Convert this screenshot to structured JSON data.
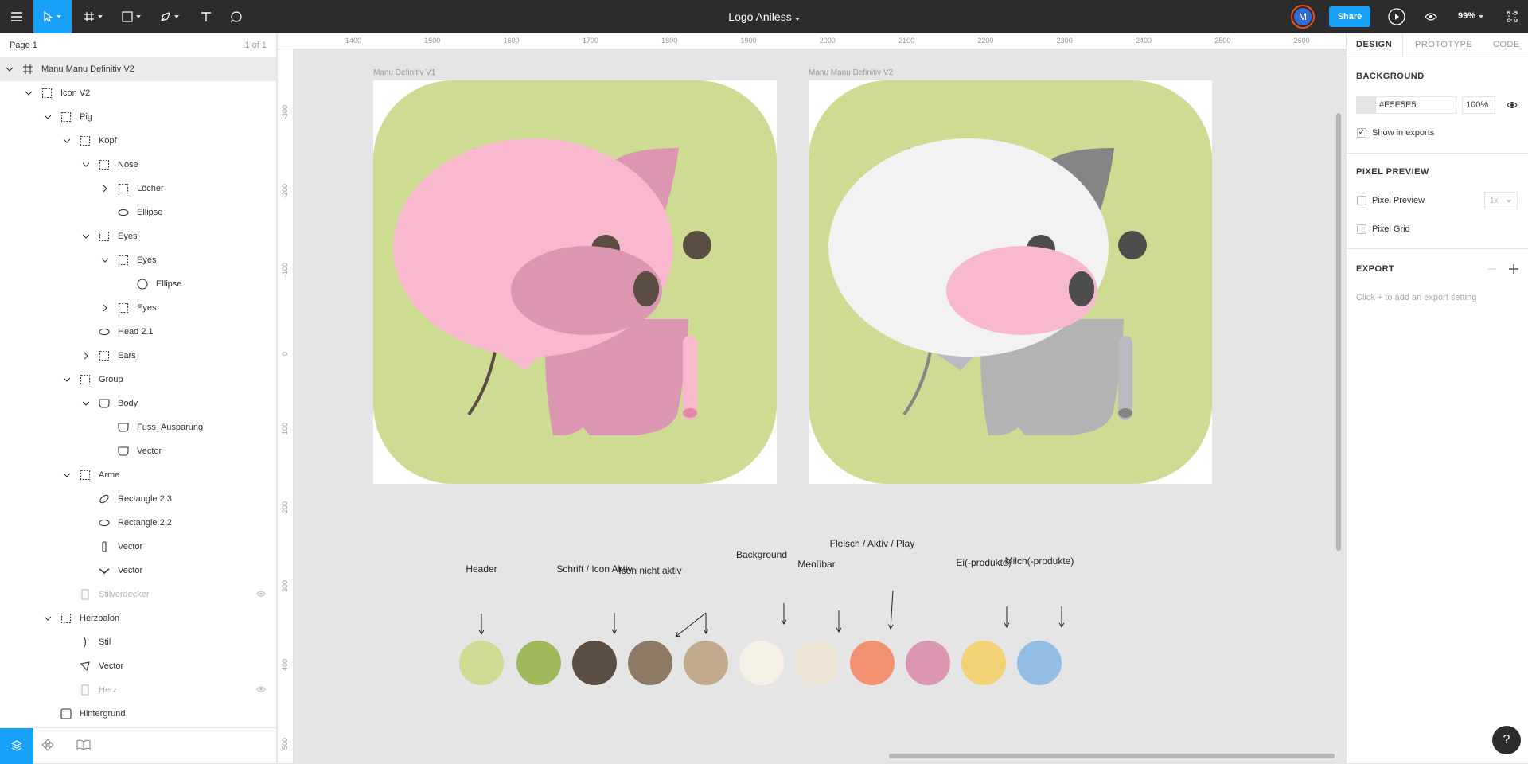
{
  "toolbar": {
    "file_title": "Logo Aniless",
    "avatar_initial": "M",
    "share_label": "Share",
    "zoom": "99%"
  },
  "layers_panel": {
    "page_name": "Page 1",
    "page_count": "1 of 1",
    "items": [
      {
        "label": "Manu Manu Definitiv V2",
        "icon": "frame-icon",
        "indent": 0,
        "chevron": "down",
        "selected": true
      },
      {
        "label": "Icon V2",
        "icon": "group-icon",
        "indent": 1,
        "chevron": "down"
      },
      {
        "label": "Pig",
        "icon": "group-icon",
        "indent": 2,
        "chevron": "down"
      },
      {
        "label": "Kopf",
        "icon": "group-icon",
        "indent": 3,
        "chevron": "down"
      },
      {
        "label": "Nose",
        "icon": "group-icon",
        "indent": 4,
        "chevron": "down"
      },
      {
        "label": "Löcher",
        "icon": "group-icon",
        "indent": 5,
        "chevron": "right"
      },
      {
        "label": "Ellipse",
        "icon": "ellipse-icon",
        "indent": 5,
        "chevron": ""
      },
      {
        "label": "Eyes",
        "icon": "group-icon",
        "indent": 4,
        "chevron": "down"
      },
      {
        "label": "Eyes",
        "icon": "group-icon",
        "indent": 5,
        "chevron": "down"
      },
      {
        "label": "Ellipse",
        "icon": "circle-icon",
        "indent": 6,
        "chevron": ""
      },
      {
        "label": "Eyes",
        "icon": "group-icon",
        "indent": 5,
        "chevron": "right"
      },
      {
        "label": "Head 2.1",
        "icon": "ellipse-icon",
        "indent": 4,
        "chevron": ""
      },
      {
        "label": "Ears",
        "icon": "group-icon",
        "indent": 4,
        "chevron": "right"
      },
      {
        "label": "Group",
        "icon": "group-icon",
        "indent": 3,
        "chevron": "down"
      },
      {
        "label": "Body",
        "icon": "vector-shape-icon",
        "indent": 4,
        "chevron": "down"
      },
      {
        "label": "Fuss_Ausparung",
        "icon": "vector-shape-icon",
        "indent": 5,
        "chevron": ""
      },
      {
        "label": "Vector",
        "icon": "vector-shape-icon",
        "indent": 5,
        "chevron": ""
      },
      {
        "label": "Arme",
        "icon": "group-icon",
        "indent": 3,
        "chevron": "down"
      },
      {
        "label": "Rectangle 2.3",
        "icon": "ellipse-tilted-icon",
        "indent": 4,
        "chevron": ""
      },
      {
        "label": "Rectangle 2.2",
        "icon": "ellipse-icon",
        "indent": 4,
        "chevron": ""
      },
      {
        "label": "Vector",
        "icon": "vertical-rect-icon",
        "indent": 4,
        "chevron": ""
      },
      {
        "label": "Vector",
        "icon": "curve-icon",
        "indent": 4,
        "chevron": ""
      },
      {
        "label": "Stilverdecker",
        "icon": "rect-icon",
        "indent": 3,
        "chevron": "",
        "hidden": true
      },
      {
        "label": "Herzbalon",
        "icon": "group-icon",
        "indent": 2,
        "chevron": "down"
      },
      {
        "label": "Stil",
        "icon": "stroke-icon",
        "indent": 3,
        "chevron": ""
      },
      {
        "label": "Vector",
        "icon": "vector-icon",
        "indent": 3,
        "chevron": ""
      },
      {
        "label": "Herz",
        "icon": "rect-icon",
        "indent": 3,
        "chevron": "",
        "hidden": true
      },
      {
        "label": "Hintergrund",
        "icon": "rounded-rect-icon",
        "indent": 2,
        "chevron": ""
      }
    ]
  },
  "rulers": {
    "x": [
      "1400",
      "1500",
      "1600",
      "1700",
      "1800",
      "1900",
      "2000",
      "2100",
      "2200",
      "2300",
      "2400",
      "2500",
      "2600"
    ],
    "y": [
      "-300",
      "-200",
      "-100",
      "0",
      "100",
      "200",
      "300",
      "400",
      "500"
    ]
  },
  "frames": [
    {
      "label": "Manu Definitiv V1",
      "variant": "pink"
    },
    {
      "label": "Manu Manu Definitiv V2",
      "variant": "white"
    }
  ],
  "palette": [
    {
      "label": "Header",
      "color": "#cddc92"
    },
    {
      "label": "",
      "color": "#9fb85a"
    },
    {
      "label": "Schrift / Icon Aktiv",
      "color": "#5c4d42"
    },
    {
      "label": "Icon nicht aktiv",
      "color": "#8d7a64"
    },
    {
      "label": "",
      "color": "#c0a98c"
    },
    {
      "label": "Background",
      "color": "#f6f1e6"
    },
    {
      "label": "Menübar",
      "color": "#efe5d4"
    },
    {
      "label": "Fleisch / Aktiv / Play",
      "color": "#f29272"
    },
    {
      "label": "",
      "color": "#db97b1"
    },
    {
      "label": "Ei(-produkte)",
      "color": "#f3d175"
    },
    {
      "label": "Milch(-produkte)",
      "color": "#93bde4"
    }
  ],
  "properties": {
    "tabs": [
      "DESIGN",
      "PROTOTYPE",
      "CODE"
    ],
    "background_title": "BACKGROUND",
    "bg_hex": "#E5E5E5",
    "bg_opacity": "100%",
    "show_in_exports": "Show in exports",
    "pixel_preview_title": "PIXEL PREVIEW",
    "pixel_preview_label": "Pixel Preview",
    "pixel_preview_scale": "1x",
    "pixel_grid_label": "Pixel Grid",
    "export_title": "EXPORT",
    "export_hint": "Click + to add an export setting"
  },
  "help_label": "?"
}
